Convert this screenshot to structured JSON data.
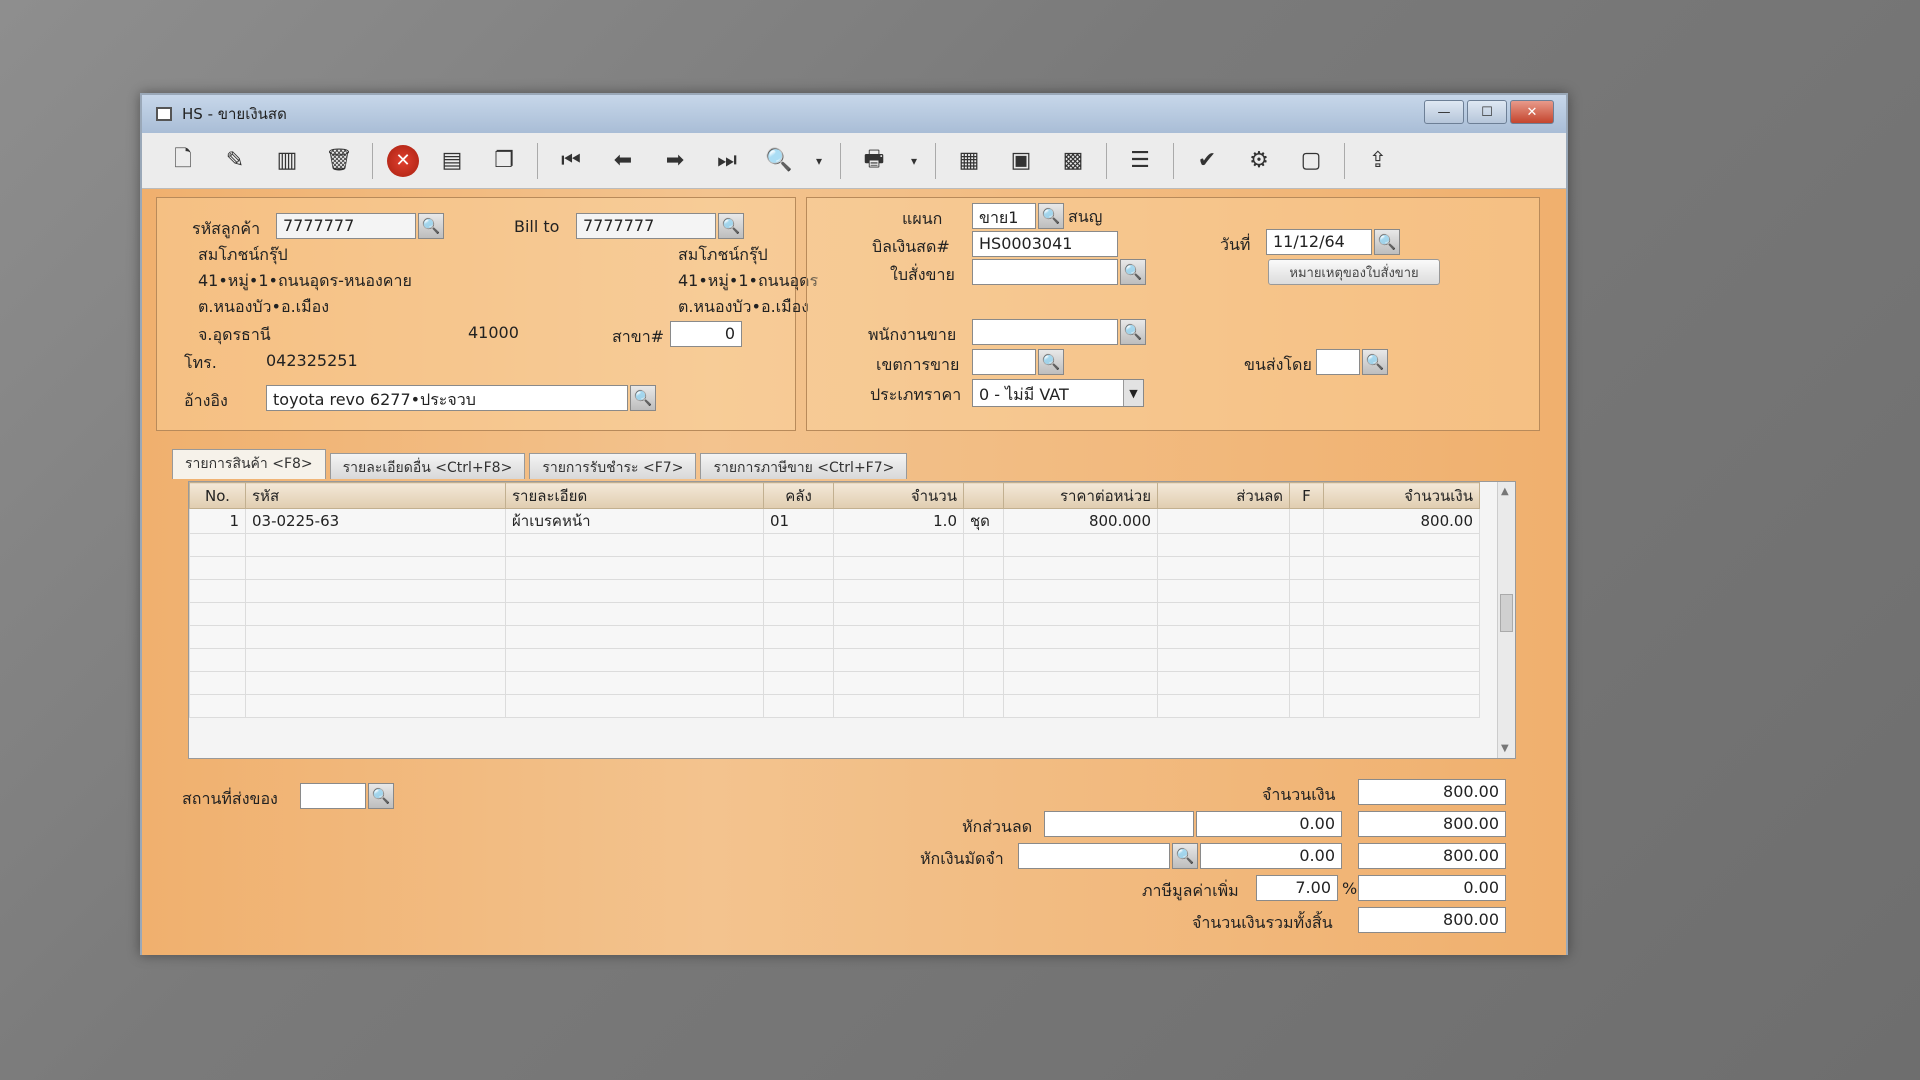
{
  "window": {
    "title": "HS - ขายเงินสด",
    "min": "—",
    "max": "☐",
    "close": "✕"
  },
  "toolbar": {
    "icons": [
      "new-document-icon",
      "edit-icon",
      "void-icon",
      "delete-trash-icon",
      "cancel-icon",
      "save-icon",
      "copy-icon",
      "first-record-icon",
      "previous-record-icon",
      "next-record-icon",
      "last-record-icon",
      "search-icon",
      "print-icon",
      "calculator-icon",
      "cash-register-icon",
      "sales-order-icon",
      "report-icon",
      "approve-ok-icon",
      "tools-icon",
      "ok-document-icon",
      "export-icon"
    ]
  },
  "customer": {
    "code_label": "รหัสลูกค้า",
    "code": "7777777",
    "name": "สมโภชน์กรุ๊ป",
    "addr1": "41•หมู่•1•ถนนอุดร-หนองคาย",
    "addr2": "ต.หนองบัว•อ.เมือง",
    "addr3": "จ.อุดรธานี",
    "postcode": "41000",
    "phone_label": "โทร.",
    "phone": "042325251",
    "ref_label": "อ้างอิง",
    "ref": "toyota revo 6277•ประจวบ",
    "billto_label": "Bill to",
    "billto": "7777777",
    "billto_name": "สมโภชน์กรุ๊ป",
    "billto_addr1": "41•หมู่•1•ถนนอุดร",
    "billto_addr2": "ต.หนองบัว•อ.เมือง",
    "branch_label": "สาขา#",
    "branch": "0"
  },
  "doc": {
    "dept_label": "แผนก",
    "dept": "ขาย1",
    "dept_name": "สนญ",
    "bill_label": "บิลเงินสด#",
    "bill": "HS0003041",
    "date_label": "วันที่",
    "date": "11/12/64",
    "order_label": "ใบสั่งขาย",
    "order": "",
    "note_button": "หมายเหตุของใบสั่งขาย",
    "salesman_label": "พนักงานขาย",
    "salesman": "",
    "area_label": "เขตการขาย",
    "area": "",
    "ship_label": "ขนส่งโดย",
    "ship": "",
    "pricetype_label": "ประเภทราคา",
    "pricetype": "0 - ไม่มี VAT"
  },
  "tabs": [
    "รายการสินค้า <F8>",
    "รายละเอียดอื่น <Ctrl+F8>",
    "รายการรับชำระ <F7>",
    "รายการภาษีขาย <Ctrl+F7>"
  ],
  "table": {
    "headers": [
      "No.",
      "รหัส",
      "รายละเอียด",
      "คลัง",
      "จำนวน",
      "",
      "ราคาต่อหน่วย",
      "ส่วนลด",
      "F",
      "จำนวนเงิน"
    ],
    "rows": [
      [
        "1",
        "03-0225-63",
        "ผ้าเบรคหน้า",
        "01",
        "1.0",
        "ชุด",
        "800.000",
        "",
        "",
        "800.00"
      ]
    ],
    "empty_rows": 8
  },
  "footer": {
    "delivery_label": "สถานที่ส่งของ",
    "delivery": "",
    "amount_label": "จำนวนเงิน",
    "amount": "800.00",
    "discount_label": "หักส่วนลด",
    "discount_input": "",
    "discount_value": "0.00",
    "after_discount": "800.00",
    "deposit_label": "หักเงินมัดจำ",
    "deposit_input": "",
    "deposit_value": "0.00",
    "after_deposit": "800.00",
    "vat_label": "ภาษีมูลค่าเพิ่ม",
    "vat_rate": "7.00",
    "vat_pct": "%",
    "vat_amount": "0.00",
    "total_label": "จำนวนเงินรวมทั้งสิ้น",
    "total": "800.00"
  }
}
